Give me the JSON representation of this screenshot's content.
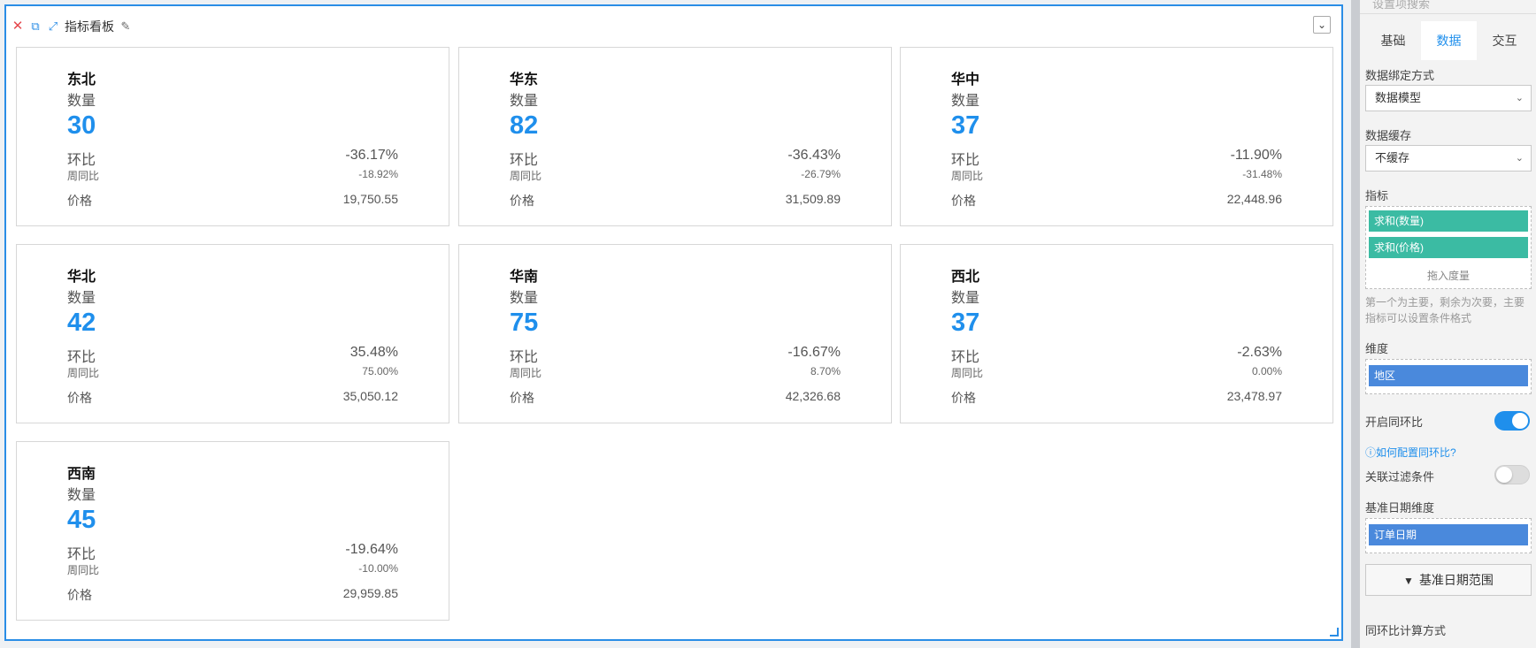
{
  "widget": {
    "title": "指标看板",
    "icons": [
      "close-icon",
      "copy-icon",
      "expand-icon",
      "pencil-icon"
    ],
    "collapse_icon": "chevron-down-icon",
    "accent_color": "#1f8fec",
    "border_color": "#2a8de6",
    "cards": [
      {
        "region": "东北",
        "metric_label": "数量",
        "value": "30",
        "hb_label": "环比",
        "hb_value": "-36.17%",
        "tb_label": "周同比",
        "tb_value": "-18.92%",
        "price_label": "价格",
        "price_value": "19,750.55"
      },
      {
        "region": "华东",
        "metric_label": "数量",
        "value": "82",
        "hb_label": "环比",
        "hb_value": "-36.43%",
        "tb_label": "周同比",
        "tb_value": "-26.79%",
        "price_label": "价格",
        "price_value": "31,509.89"
      },
      {
        "region": "华中",
        "metric_label": "数量",
        "value": "37",
        "hb_label": "环比",
        "hb_value": "-11.90%",
        "tb_label": "周同比",
        "tb_value": "-31.48%",
        "price_label": "价格",
        "price_value": "22,448.96"
      },
      {
        "region": "华北",
        "metric_label": "数量",
        "value": "42",
        "hb_label": "环比",
        "hb_value": "35.48%",
        "tb_label": "周同比",
        "tb_value": "75.00%",
        "price_label": "价格",
        "price_value": "35,050.12"
      },
      {
        "region": "华南",
        "metric_label": "数量",
        "value": "75",
        "hb_label": "环比",
        "hb_value": "-16.67%",
        "tb_label": "周同比",
        "tb_value": "8.70%",
        "price_label": "价格",
        "price_value": "42,326.68"
      },
      {
        "region": "西北",
        "metric_label": "数量",
        "value": "37",
        "hb_label": "环比",
        "hb_value": "-2.63%",
        "tb_label": "周同比",
        "tb_value": "0.00%",
        "price_label": "价格",
        "price_value": "23,478.97"
      },
      {
        "region": "西南",
        "metric_label": "数量",
        "value": "45",
        "hb_label": "环比",
        "hb_value": "-19.64%",
        "tb_label": "周同比",
        "tb_value": "-10.00%",
        "price_label": "价格",
        "price_value": "29,959.85"
      }
    ]
  },
  "panel": {
    "search_placeholder": "设置项搜索",
    "tabs": [
      {
        "label": "基础"
      },
      {
        "label": "数据",
        "active": true
      },
      {
        "label": "交互"
      }
    ],
    "binding_label": "数据绑定方式",
    "binding_value": "数据模型",
    "cache_label": "数据缓存",
    "cache_value": "不缓存",
    "metrics_label": "指标",
    "metrics": [
      "求和(数量)",
      "求和(价格)"
    ],
    "metrics_drop_hint": "拖入度量",
    "metrics_hint": "第一个为主要，剩余为次要，主要指标可以设置条件格式",
    "dimension_label": "维度",
    "dimensions": [
      "地区"
    ],
    "yoy_label": "开启同环比",
    "yoy_enabled": true,
    "yoy_help_link": "如何配置同环比?",
    "filter_link_label": "关联过滤条件",
    "filter_link_enabled": false,
    "base_date_label": "基准日期维度",
    "base_date_field": "订单日期",
    "base_date_range_button": "基准日期范围",
    "calc_method_label": "同环比计算方式"
  }
}
